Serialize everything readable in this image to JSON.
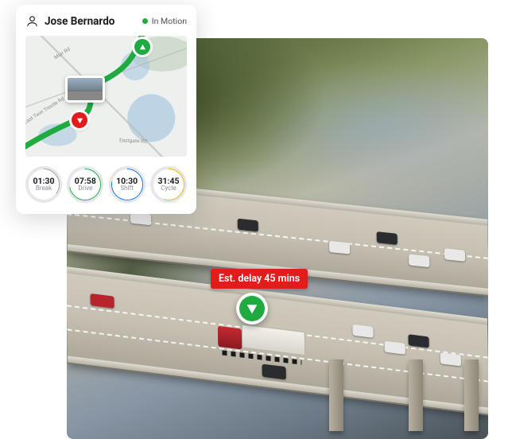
{
  "driver": {
    "name": "Jose Bernardo",
    "status_label": "In Motion"
  },
  "map": {
    "road_labels": [
      "Muir Rd",
      "East Twin Trestle Rd",
      "Eastgate Rd"
    ]
  },
  "gauges": [
    {
      "value": "01:30",
      "label": "Break",
      "color": "#9aa0a6",
      "pct": 35
    },
    {
      "value": "07:58",
      "label": "Drive",
      "color": "#1fab3f",
      "pct": 72
    },
    {
      "value": "10:30",
      "label": "Shift",
      "color": "#1a73e8",
      "pct": 78
    },
    {
      "value": "31:45",
      "label": "Cycle",
      "color": "#f5b400",
      "pct": 55
    }
  ],
  "overlay": {
    "delay_label": "Est. delay 45 mins"
  }
}
